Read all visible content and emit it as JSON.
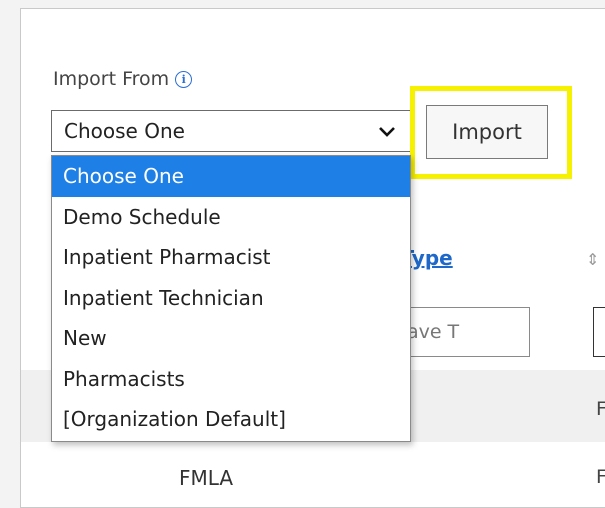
{
  "import_section": {
    "label": "Import From",
    "info_icon": "info-icon",
    "select_value": "Choose One",
    "options": [
      "Choose One",
      "Demo Schedule",
      "Inpatient Pharmacist",
      "Inpatient Technician",
      "New",
      "Pharmacists",
      "[Organization Default]"
    ],
    "selected_index": 0,
    "import_button": "Import",
    "highlight_color": "#f6f100"
  },
  "table": {
    "column_header": "e Type",
    "filter_placeholder": "Leave T",
    "row_value": "FMLA",
    "partial_col_letter": "F"
  },
  "colors": {
    "accent": "#1e7fe6",
    "link": "#1d68c8"
  }
}
